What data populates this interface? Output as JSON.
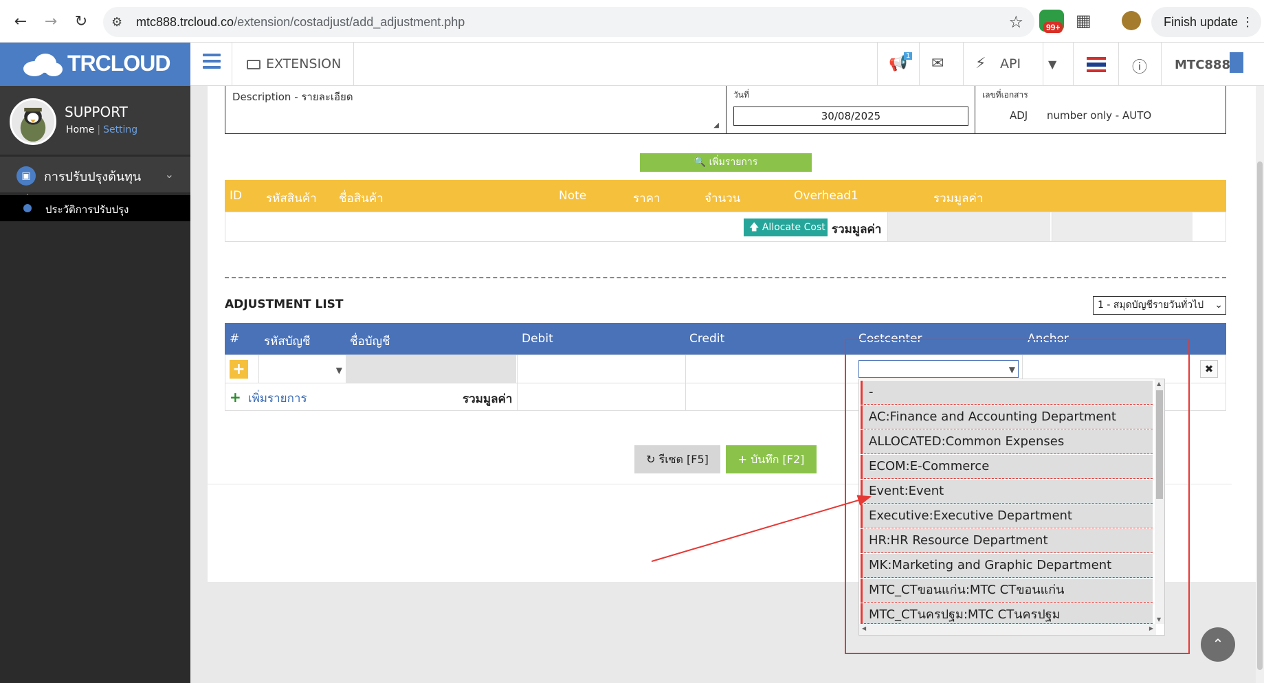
{
  "browser": {
    "url_host": "mtc888.trcloud.co",
    "url_path": "/extension/costadjust/add_adjustment.php",
    "ext_badge": "99+",
    "finish_update": "Finish update"
  },
  "app": {
    "logo": "TRCLOUD",
    "user_name": "SUPPORT",
    "home_link": "Home",
    "setting_link": "Setting",
    "menu_main": "การปรับปรุงต้นทุน",
    "menu_sub": "ประวัติการปรับปรุง",
    "topbar": {
      "extension": "EXTENSION",
      "api": "API",
      "user_code": "MTC888",
      "notify_badge": "1"
    }
  },
  "form": {
    "description_label": "Description - รายละเอียด",
    "date_label": "วันที่",
    "date_value": "30/08/2025",
    "doc_label": "เลขที่เอกสาร",
    "doc_prefix": "ADJ",
    "doc_auto": "number only - AUTO"
  },
  "items": {
    "add_button": "เพิ่มรายการ",
    "columns": [
      "ID",
      "รหัสสินค้า",
      "ชื่อสินค้า",
      "Note",
      "ราคา",
      "จำนวน",
      "Overhead1",
      "รวมมูลค่า"
    ],
    "allocate_button": "Allocate Cost",
    "total_label": "รวมมูลค่า"
  },
  "adjustment": {
    "title": "ADJUSTMENT LIST",
    "journal_select": "1 - สมุดบัญชีรายวันทั่วไป",
    "columns": [
      "#",
      "รหัสบัญชี",
      "ชื่อบัญชี",
      "Debit",
      "Credit",
      "Costcenter",
      "Anchor"
    ],
    "add_line": "เพิ่มรายการ",
    "total_label": "รวมมูลค่า",
    "costcenter_options": [
      "-",
      "AC:Finance and Accounting Department",
      "ALLOCATED:Common Expenses",
      "ECOM:E-Commerce",
      "Event:Event",
      "Executive:Executive Department",
      "HR:HR Resource Department",
      "MK:Marketing and Graphic Department",
      "MTC_CTขอนแก่น:MTC CTขอนแก่น",
      "MTC_CTนครปฐม:MTC CTนครปฐม"
    ]
  },
  "actions": {
    "reset": "รีเซต [F5]",
    "save": "บันทึก [F2]"
  },
  "colors": {
    "brand_blue": "#4a7dc4",
    "items_header": "#f5c03c",
    "adj_header": "#4a72b8",
    "green": "#8bc34a",
    "teal": "#26a69a",
    "annotation_red": "#e53935"
  }
}
